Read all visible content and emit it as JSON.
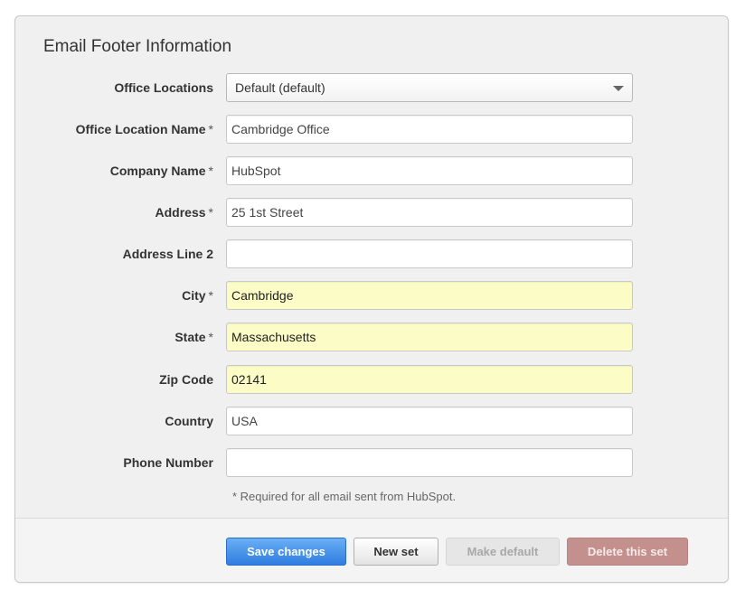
{
  "title": "Email Footer Information",
  "required_marker": "*",
  "office_locations": {
    "label": "Office Locations",
    "selected": "Default (default)"
  },
  "fields": {
    "office_location_name": {
      "label": "Office Location Name",
      "value": "Cambridge Office"
    },
    "company_name": {
      "label": "Company Name",
      "value": "HubSpot"
    },
    "address": {
      "label": "Address",
      "value": "25 1st Street"
    },
    "address_line_2": {
      "label": "Address Line 2",
      "value": ""
    },
    "city": {
      "label": "City",
      "value": "Cambridge"
    },
    "state": {
      "label": "State",
      "value": "Massachusetts"
    },
    "zip_code": {
      "label": "Zip Code",
      "value": "02141"
    },
    "country": {
      "label": "Country",
      "value": "USA"
    },
    "phone_number": {
      "label": "Phone Number",
      "value": ""
    }
  },
  "note": "* Required for all email sent from HubSpot.",
  "buttons": {
    "save": "Save changes",
    "new_set": "New set",
    "make_default": "Make default",
    "delete_set": "Delete this set"
  },
  "colors": {
    "autofill_background": "#fbfcc6",
    "primary_button": "#2f7ee0",
    "delete_button": "#c4908e"
  }
}
